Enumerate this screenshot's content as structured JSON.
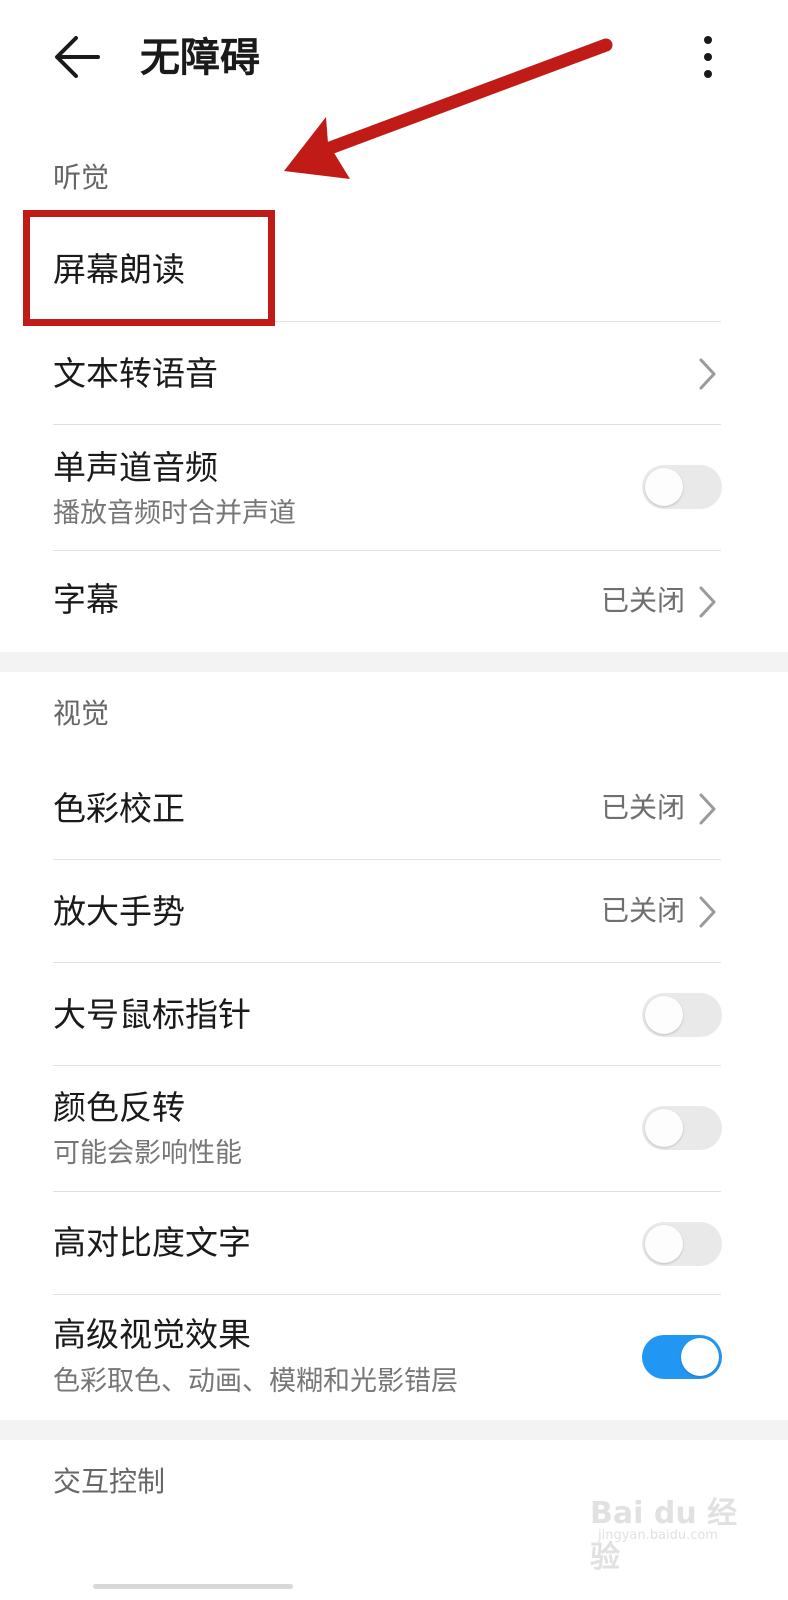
{
  "header": {
    "title": "无障碍"
  },
  "hearing": {
    "section_label": "听觉",
    "screen_reader": {
      "title": "屏幕朗读"
    },
    "tts": {
      "title": "文本转语音"
    },
    "mono_audio": {
      "title": "单声道音频",
      "subtitle": "播放音频时合并声道",
      "enabled": false
    },
    "captions": {
      "title": "字幕",
      "status": "已关闭"
    }
  },
  "vision": {
    "section_label": "视觉",
    "color_correction": {
      "title": "色彩校正",
      "status": "已关闭"
    },
    "magnification": {
      "title": "放大手势",
      "status": "已关闭"
    },
    "large_pointer": {
      "title": "大号鼠标指针",
      "enabled": false
    },
    "color_inversion": {
      "title": "颜色反转",
      "subtitle": "可能会影响性能",
      "enabled": false
    },
    "high_contrast_text": {
      "title": "高对比度文字",
      "enabled": false
    },
    "advanced_visual_effects": {
      "title": "高级视觉效果",
      "subtitle": "色彩取色、动画、模糊和光影错层",
      "enabled": true
    }
  },
  "interaction": {
    "section_label": "交互控制"
  },
  "watermark": {
    "text": "Bai du 经验",
    "sub": "jingyan.baidu.com"
  },
  "colors": {
    "annotation_red": "#c11b17",
    "toggle_on": "#2196f3"
  },
  "icons": [
    "back-arrow-icon",
    "more-vertical-icon",
    "chevron-right-icon"
  ]
}
